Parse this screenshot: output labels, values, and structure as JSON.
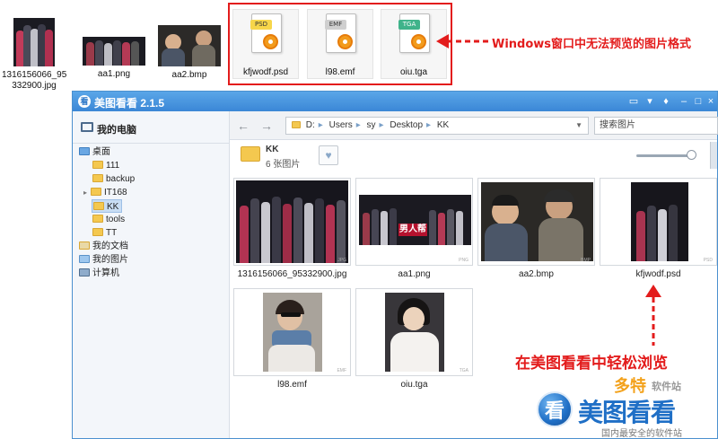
{
  "desktop_files": [
    {
      "name_line1": "1316156066_95",
      "name_line2": "332900.jpg",
      "kind": "photo"
    },
    {
      "name_line1": "aa1.png",
      "name_line2": "",
      "kind": "photo"
    },
    {
      "name_line1": "aa2.bmp",
      "name_line2": "",
      "kind": "photo"
    },
    {
      "name_line1": "kfjwodf.psd",
      "name_line2": "",
      "kind": "doc",
      "tag": "PSD",
      "tag_color": "#f7d64a"
    },
    {
      "name_line1": "l98.emf",
      "name_line2": "",
      "kind": "doc",
      "tag": "EMF",
      "tag_color": "#cfcfcf"
    },
    {
      "name_line1": "oiu.tga",
      "name_line2": "",
      "kind": "doc",
      "tag": "TGA",
      "tag_color": "#3fb38a"
    }
  ],
  "notes": {
    "windows_cannot_preview": "Windows窗口中无法预览的图片格式",
    "easy_browse": "在美图看看中轻松浏览"
  },
  "app": {
    "title": "美图看看 2.1.5",
    "logo_glyph": "看",
    "title_buttons": [
      "▭",
      "▾",
      "♦",
      "–",
      "□",
      "×"
    ]
  },
  "sidebar": {
    "header": "我的电脑",
    "tree": [
      {
        "label": "桌面",
        "level": 0,
        "icon": "desktop-icon"
      },
      {
        "label": "111",
        "level": 1,
        "icon": "folder-icon"
      },
      {
        "label": "backup",
        "level": 1,
        "icon": "folder-icon"
      },
      {
        "label": "IT168",
        "level": 1,
        "icon": "folder-icon",
        "expandable": true
      },
      {
        "label": "KK",
        "level": 1,
        "icon": "folder-icon",
        "selected": true
      },
      {
        "label": "tools",
        "level": 1,
        "icon": "folder-icon"
      },
      {
        "label": "TT",
        "level": 1,
        "icon": "folder-icon"
      },
      {
        "label": "我的文档",
        "level": 0,
        "icon": "docs-icon"
      },
      {
        "label": "我的图片",
        "level": 0,
        "icon": "pictures-icon"
      },
      {
        "label": "计算机",
        "level": 0,
        "icon": "computer-icon"
      }
    ]
  },
  "nav": {
    "path": [
      "D:",
      "Users",
      "sy",
      "Desktop",
      "KK"
    ],
    "search_placeholder": "搜索图片"
  },
  "folder": {
    "name": "KK",
    "count": "6 张图片",
    "zoom_fraction": 0.93
  },
  "thumbnails": [
    {
      "name": "1316156066_95332900.jpg",
      "ext": "JPG"
    },
    {
      "name": "aa1.png",
      "ext": "PNG"
    },
    {
      "name": "aa2.bmp",
      "ext": "BMP"
    },
    {
      "name": "kfjwodf.psd",
      "ext": "PSD"
    },
    {
      "name": "l98.emf",
      "ext": "EMF"
    },
    {
      "name": "oiu.tga",
      "ext": "TGA"
    }
  ],
  "aa1_banner": "男人帮",
  "brand": {
    "logo_glyph": "看",
    "name": "美图看看",
    "watermark": "多特",
    "watermark_sub": "软件站",
    "tagline": "国内最安全的软件站"
  },
  "colors": {
    "accent_red": "#e31c1c",
    "title_blue": "#3b87d6",
    "brand_blue": "#1f6fc6"
  }
}
